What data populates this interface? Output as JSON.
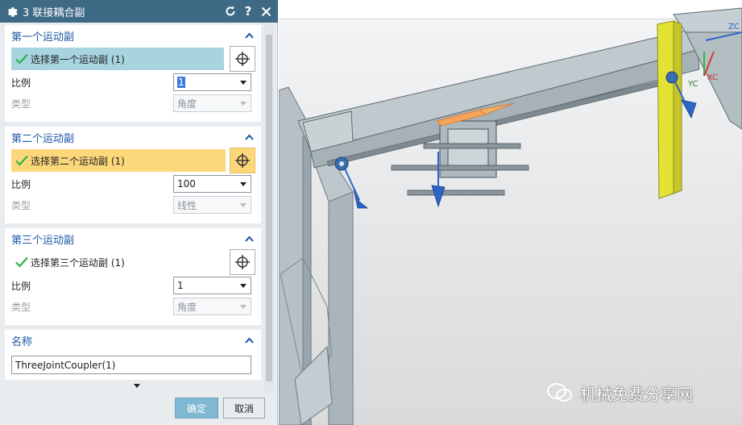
{
  "dialog": {
    "title": "3 联接耦合副",
    "title_buttons": [
      "reset-icon",
      "help-icon",
      "close-icon"
    ]
  },
  "groups": [
    {
      "header": "第一个运动副",
      "select_label": "选择第一个运动副 (1)",
      "select_color": "#a8d4e0",
      "ratio_label": "比例",
      "ratio_value": "1",
      "type_label": "类型",
      "type_value": "角度"
    },
    {
      "header": "第二个运动副",
      "select_label": "选择第二个运动副 (1)",
      "select_color": "#fcd87a",
      "ratio_label": "比例",
      "ratio_value": "100",
      "type_label": "类型",
      "type_value": "线性"
    },
    {
      "header": "第三个运动副",
      "select_label": "选择第三个运动副 (1)",
      "select_color": "#ffffff",
      "ratio_label": "比例",
      "ratio_value": "1",
      "type_label": "类型",
      "type_value": "角度"
    }
  ],
  "name_group": {
    "header": "名称",
    "value": "ThreeJointCoupler(1)"
  },
  "buttons": {
    "ok": "确定",
    "cancel": "取消"
  },
  "viewport": {
    "axis_labels": [
      "ZC",
      "YC",
      "XC"
    ],
    "watermark": "机械免费分享网"
  },
  "colors": {
    "titlebar": "#3e6a86",
    "accent": "#1a56a6",
    "ok_button": "#7fb8d3"
  }
}
